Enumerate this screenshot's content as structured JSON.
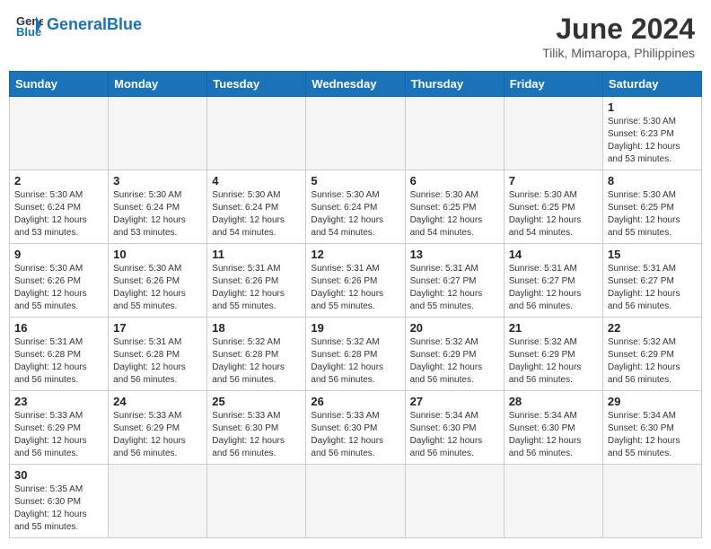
{
  "header": {
    "logo_general": "General",
    "logo_blue": "Blue",
    "month_title": "June 2024",
    "subtitle": "Tilik, Mimaropa, Philippines"
  },
  "weekdays": [
    "Sunday",
    "Monday",
    "Tuesday",
    "Wednesday",
    "Thursday",
    "Friday",
    "Saturday"
  ],
  "weeks": [
    [
      {
        "day": "",
        "info": ""
      },
      {
        "day": "",
        "info": ""
      },
      {
        "day": "",
        "info": ""
      },
      {
        "day": "",
        "info": ""
      },
      {
        "day": "",
        "info": ""
      },
      {
        "day": "",
        "info": ""
      },
      {
        "day": "1",
        "info": "Sunrise: 5:30 AM\nSunset: 6:23 PM\nDaylight: 12 hours and 53 minutes."
      }
    ],
    [
      {
        "day": "2",
        "info": "Sunrise: 5:30 AM\nSunset: 6:24 PM\nDaylight: 12 hours and 53 minutes."
      },
      {
        "day": "3",
        "info": "Sunrise: 5:30 AM\nSunset: 6:24 PM\nDaylight: 12 hours and 53 minutes."
      },
      {
        "day": "4",
        "info": "Sunrise: 5:30 AM\nSunset: 6:24 PM\nDaylight: 12 hours and 54 minutes."
      },
      {
        "day": "5",
        "info": "Sunrise: 5:30 AM\nSunset: 6:24 PM\nDaylight: 12 hours and 54 minutes."
      },
      {
        "day": "6",
        "info": "Sunrise: 5:30 AM\nSunset: 6:25 PM\nDaylight: 12 hours and 54 minutes."
      },
      {
        "day": "7",
        "info": "Sunrise: 5:30 AM\nSunset: 6:25 PM\nDaylight: 12 hours and 54 minutes."
      },
      {
        "day": "8",
        "info": "Sunrise: 5:30 AM\nSunset: 6:25 PM\nDaylight: 12 hours and 55 minutes."
      }
    ],
    [
      {
        "day": "9",
        "info": "Sunrise: 5:30 AM\nSunset: 6:26 PM\nDaylight: 12 hours and 55 minutes."
      },
      {
        "day": "10",
        "info": "Sunrise: 5:30 AM\nSunset: 6:26 PM\nDaylight: 12 hours and 55 minutes."
      },
      {
        "day": "11",
        "info": "Sunrise: 5:31 AM\nSunset: 6:26 PM\nDaylight: 12 hours and 55 minutes."
      },
      {
        "day": "12",
        "info": "Sunrise: 5:31 AM\nSunset: 6:26 PM\nDaylight: 12 hours and 55 minutes."
      },
      {
        "day": "13",
        "info": "Sunrise: 5:31 AM\nSunset: 6:27 PM\nDaylight: 12 hours and 55 minutes."
      },
      {
        "day": "14",
        "info": "Sunrise: 5:31 AM\nSunset: 6:27 PM\nDaylight: 12 hours and 56 minutes."
      },
      {
        "day": "15",
        "info": "Sunrise: 5:31 AM\nSunset: 6:27 PM\nDaylight: 12 hours and 56 minutes."
      }
    ],
    [
      {
        "day": "16",
        "info": "Sunrise: 5:31 AM\nSunset: 6:28 PM\nDaylight: 12 hours and 56 minutes."
      },
      {
        "day": "17",
        "info": "Sunrise: 5:31 AM\nSunset: 6:28 PM\nDaylight: 12 hours and 56 minutes."
      },
      {
        "day": "18",
        "info": "Sunrise: 5:32 AM\nSunset: 6:28 PM\nDaylight: 12 hours and 56 minutes."
      },
      {
        "day": "19",
        "info": "Sunrise: 5:32 AM\nSunset: 6:28 PM\nDaylight: 12 hours and 56 minutes."
      },
      {
        "day": "20",
        "info": "Sunrise: 5:32 AM\nSunset: 6:29 PM\nDaylight: 12 hours and 56 minutes."
      },
      {
        "day": "21",
        "info": "Sunrise: 5:32 AM\nSunset: 6:29 PM\nDaylight: 12 hours and 56 minutes."
      },
      {
        "day": "22",
        "info": "Sunrise: 5:32 AM\nSunset: 6:29 PM\nDaylight: 12 hours and 56 minutes."
      }
    ],
    [
      {
        "day": "23",
        "info": "Sunrise: 5:33 AM\nSunset: 6:29 PM\nDaylight: 12 hours and 56 minutes."
      },
      {
        "day": "24",
        "info": "Sunrise: 5:33 AM\nSunset: 6:29 PM\nDaylight: 12 hours and 56 minutes."
      },
      {
        "day": "25",
        "info": "Sunrise: 5:33 AM\nSunset: 6:30 PM\nDaylight: 12 hours and 56 minutes."
      },
      {
        "day": "26",
        "info": "Sunrise: 5:33 AM\nSunset: 6:30 PM\nDaylight: 12 hours and 56 minutes."
      },
      {
        "day": "27",
        "info": "Sunrise: 5:34 AM\nSunset: 6:30 PM\nDaylight: 12 hours and 56 minutes."
      },
      {
        "day": "28",
        "info": "Sunrise: 5:34 AM\nSunset: 6:30 PM\nDaylight: 12 hours and 56 minutes."
      },
      {
        "day": "29",
        "info": "Sunrise: 5:34 AM\nSunset: 6:30 PM\nDaylight: 12 hours and 55 minutes."
      }
    ],
    [
      {
        "day": "30",
        "info": "Sunrise: 5:35 AM\nSunset: 6:30 PM\nDaylight: 12 hours and 55 minutes."
      },
      {
        "day": "",
        "info": ""
      },
      {
        "day": "",
        "info": ""
      },
      {
        "day": "",
        "info": ""
      },
      {
        "day": "",
        "info": ""
      },
      {
        "day": "",
        "info": ""
      },
      {
        "day": "",
        "info": ""
      }
    ]
  ]
}
